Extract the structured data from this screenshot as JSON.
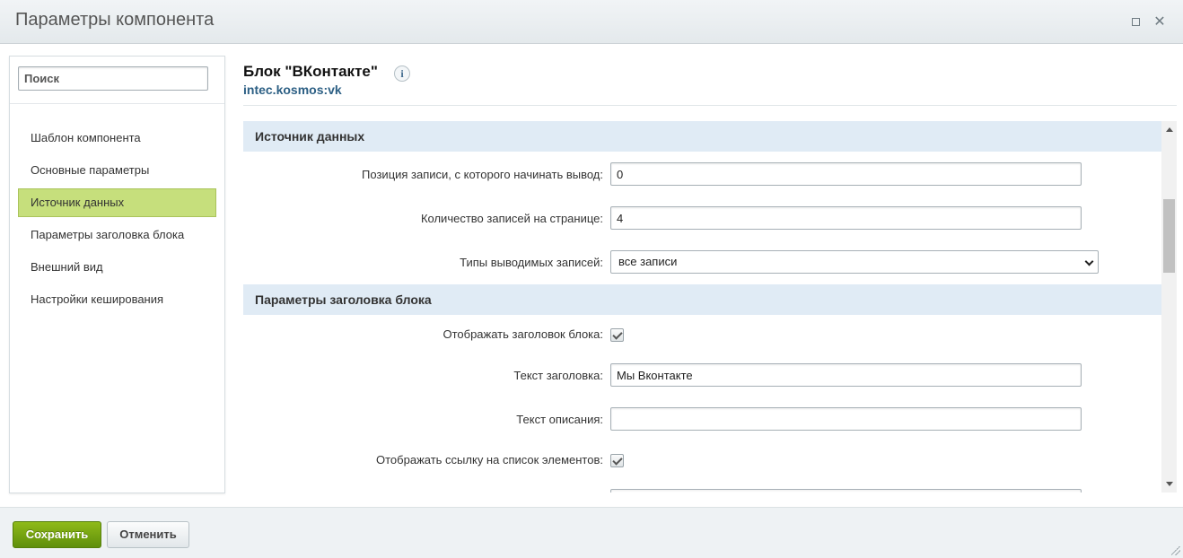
{
  "window": {
    "title": "Параметры компонента",
    "maximize_icon": "maximize-icon",
    "close_icon": "close-icon",
    "close_glyph": "✕"
  },
  "sidebar": {
    "search_placeholder": "Поиск",
    "items": [
      {
        "label": "Шаблон компонента",
        "active": false
      },
      {
        "label": "Основные параметры",
        "active": false
      },
      {
        "label": "Источник данных",
        "active": true
      },
      {
        "label": "Параметры заголовка блока",
        "active": false
      },
      {
        "label": "Внешний вид",
        "active": false
      },
      {
        "label": "Настройки кеширования",
        "active": false
      }
    ]
  },
  "header": {
    "title": "Блок \"ВКонтакте\"",
    "info_glyph": "i",
    "subtitle": "intec.kosmos:vk"
  },
  "sections": [
    {
      "title": "Источник данных",
      "fields": [
        {
          "label": "Позиция записи, с которого начинать вывод:",
          "type": "text",
          "value": "0"
        },
        {
          "label": "Количество записей на странице:",
          "type": "text",
          "value": "4"
        },
        {
          "label": "Типы выводимых записей:",
          "type": "select",
          "value": "все записи"
        }
      ]
    },
    {
      "title": "Параметры заголовка блока",
      "fields": [
        {
          "label": "Отображать заголовок блока:",
          "type": "checkbox",
          "checked": true
        },
        {
          "label": "Текст заголовка:",
          "type": "text",
          "value": "Мы Вконтакте"
        },
        {
          "label": "Текст описания:",
          "type": "text",
          "value": ""
        },
        {
          "label": "Отображать ссылку на список элементов:",
          "type": "checkbox",
          "checked": true
        }
      ]
    }
  ],
  "footer": {
    "save_label": "Сохранить",
    "cancel_label": "Отменить"
  },
  "colors": {
    "active_nav_bg": "#c6df7c",
    "section_head_bg": "#e0ebf5",
    "save_button": "#7aa614",
    "subtitle": "#2c5f84"
  }
}
